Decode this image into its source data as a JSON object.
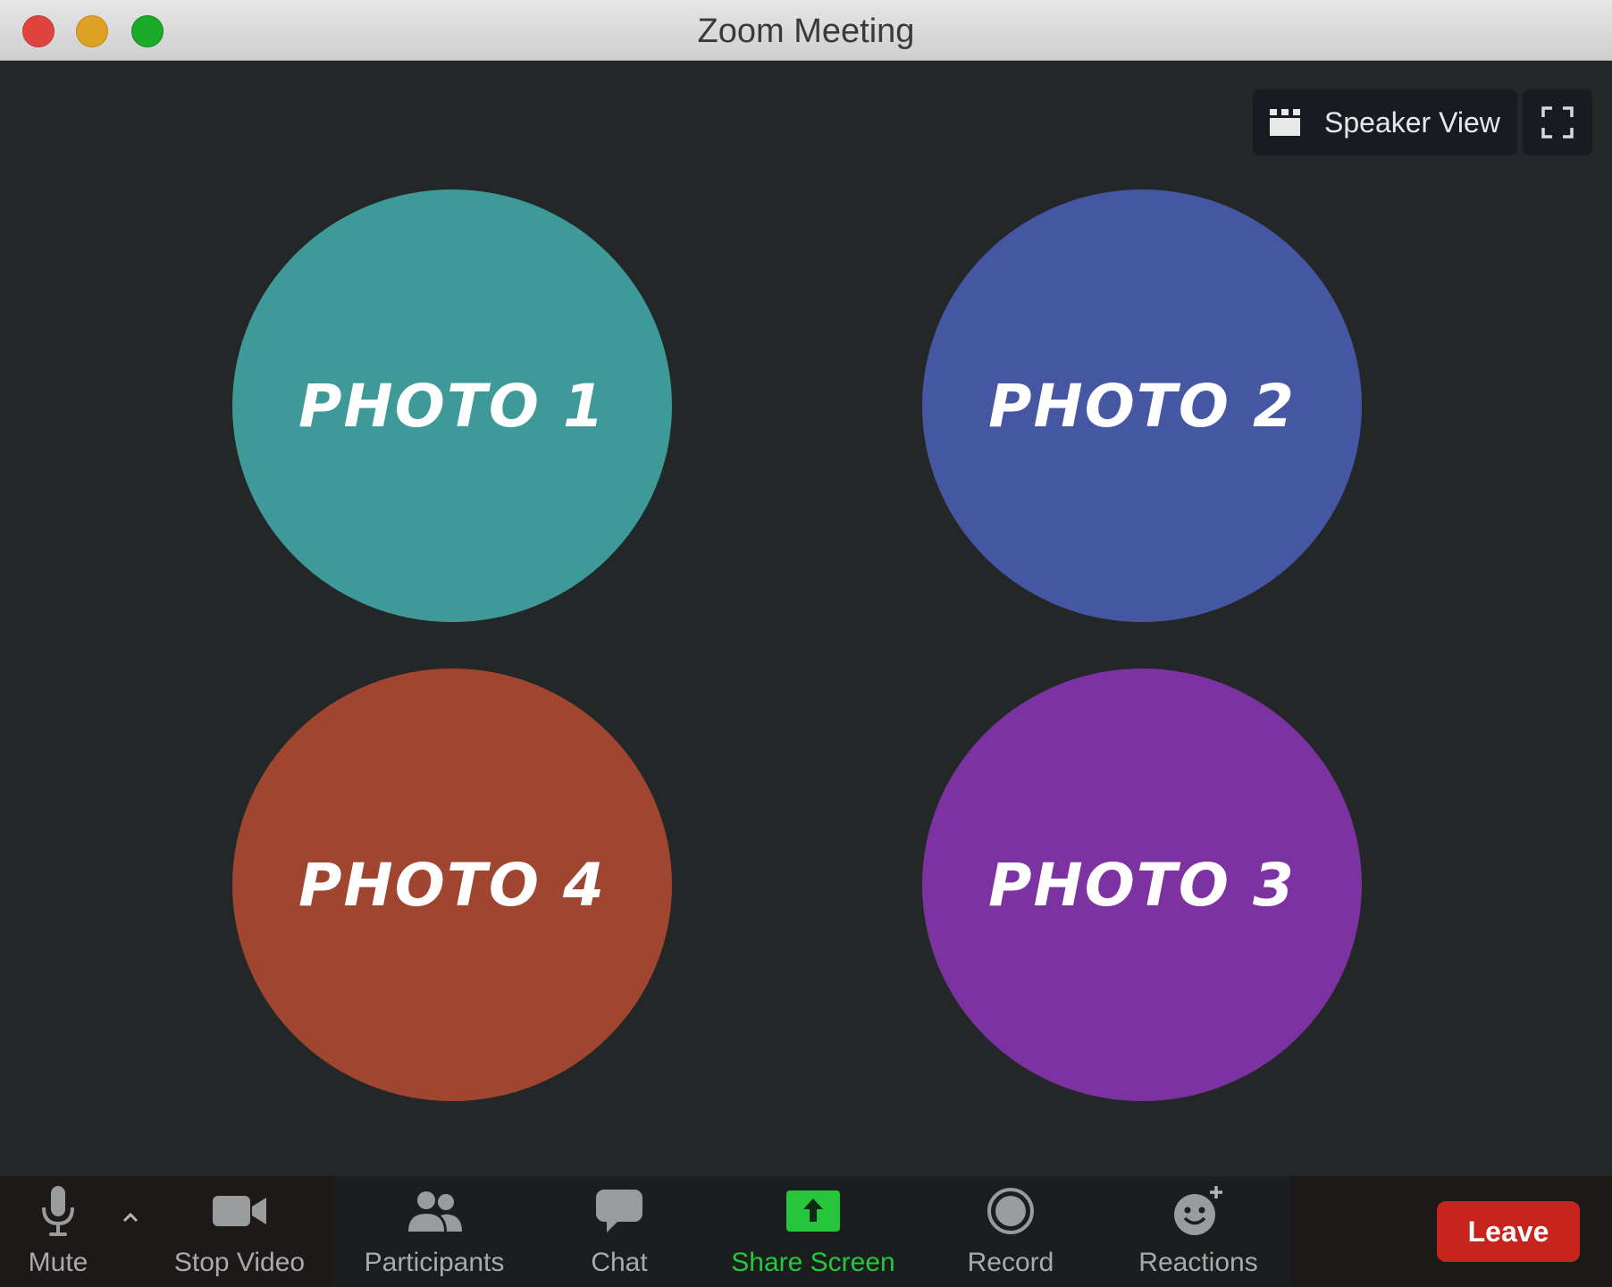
{
  "window": {
    "title": "Zoom Meeting"
  },
  "topbar": {
    "view_label": "Speaker View",
    "view_icon": "grid-icon",
    "fullscreen_icon": "fullscreen-icon"
  },
  "participants": [
    {
      "label": "PHOTO 1",
      "color": "#3e9a99"
    },
    {
      "label": "PHOTO 2",
      "color": "#4557a2"
    },
    {
      "label": "PHOTO 4",
      "color": "#a04630"
    },
    {
      "label": "PHOTO 3",
      "color": "#7c33a1"
    }
  ],
  "toolbar": {
    "mute": {
      "label": "Mute",
      "icon": "microphone-icon"
    },
    "stop_video": {
      "label": "Stop Video",
      "icon": "video-camera-icon"
    },
    "participants": {
      "label": "Participants",
      "icon": "people-icon"
    },
    "chat": {
      "label": "Chat",
      "icon": "chat-bubble-icon"
    },
    "share_screen": {
      "label": "Share Screen",
      "icon": "share-screen-icon",
      "color": "#26c63c"
    },
    "record": {
      "label": "Record",
      "icon": "record-icon"
    },
    "reactions": {
      "label": "Reactions",
      "icon": "smiley-plus-icon"
    },
    "leave": {
      "label": "Leave",
      "color": "#c9231e"
    }
  }
}
